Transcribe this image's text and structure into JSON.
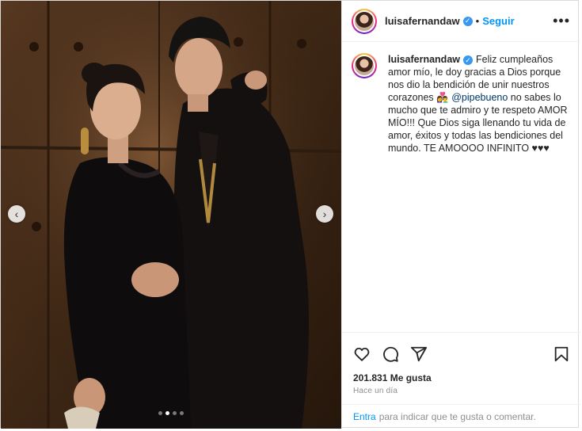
{
  "post": {
    "username": "luisafernandaw",
    "verified_mark": "✓",
    "follow_label": "Seguir",
    "separator": "•",
    "more_icon": "•••",
    "caption": {
      "username": "luisafernandaw",
      "part1": "Feliz cumpleaños amor mío, le doy gracias a Dios porque nos dio la bendición de unir nuestros corazones ",
      "emoji": "👩‍❤️‍👨",
      "mention": "@pipebueno",
      "part2": " no sabes lo mucho que te admiro y te respeto AMOR MÍO!!! Que Dios siga llenando tu vida de amor, éxitos y todas las bendiciones del mundo. TE AMOOOO INFINITO ",
      "hearts": "♥♥♥"
    },
    "likes": "201.831 Me gusta",
    "time": "Hace un día",
    "footer": {
      "login_label": "Entra",
      "rest": "para indicar que te gusta o comentar."
    }
  },
  "carousel": {
    "total": 4,
    "active_index": 1,
    "prev_icon": "‹",
    "next_icon": "›"
  },
  "icons": [
    "heart-icon",
    "comment-icon",
    "share-icon",
    "bookmark-icon",
    "verified-icon",
    "more-options-icon",
    "chevron-left-icon",
    "chevron-right-icon"
  ],
  "colors": {
    "link": "#0095f6",
    "mention": "#00376b",
    "verified": "#3897f0",
    "muted": "#8e8e8e"
  }
}
